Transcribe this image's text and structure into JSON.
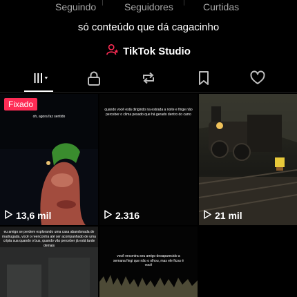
{
  "stats": [
    {
      "label": "Seguindo"
    },
    {
      "label": "Seguidores"
    },
    {
      "label": "Curtidas"
    }
  ],
  "bio": "só conteúdo que dá cagacinho",
  "studio": {
    "label": "TikTok Studio",
    "icon": "user-star-icon",
    "icon_color": "#fe2c55"
  },
  "tabs": [
    {
      "name": "videos",
      "icon": "grid-icon",
      "active": true
    },
    {
      "name": "private",
      "icon": "lock-icon"
    },
    {
      "name": "reposts",
      "icon": "repost-icon"
    },
    {
      "name": "favorites",
      "icon": "bookmark-icon"
    },
    {
      "name": "liked",
      "icon": "heart-icon"
    }
  ],
  "videos": [
    {
      "pinned_label": "Fixado",
      "caption": "oh, agora faz sentido",
      "views": "13,6 mil"
    },
    {
      "caption": "quando você está dirigindo na estrada a noite e finge não perceber o clima pesado que há gerado dentro do carro",
      "views": "2.316"
    },
    {
      "views": "21 mil"
    },
    {
      "caption": "eu amigo se perdem explorando uma casa abandonada de madrugada, você o reencontra até ser acompanhado de uma crípta sua quando o bus, quando vão perceber já está tarde demais"
    },
    {
      "caption": "você encontra seu amigo desaparecido a semana fingi que não o olhou, mas ele ficou é você"
    },
    {}
  ],
  "colors": {
    "accent": "#fe2c55",
    "background": "#000000",
    "muted_text": "#a7a7a7"
  }
}
